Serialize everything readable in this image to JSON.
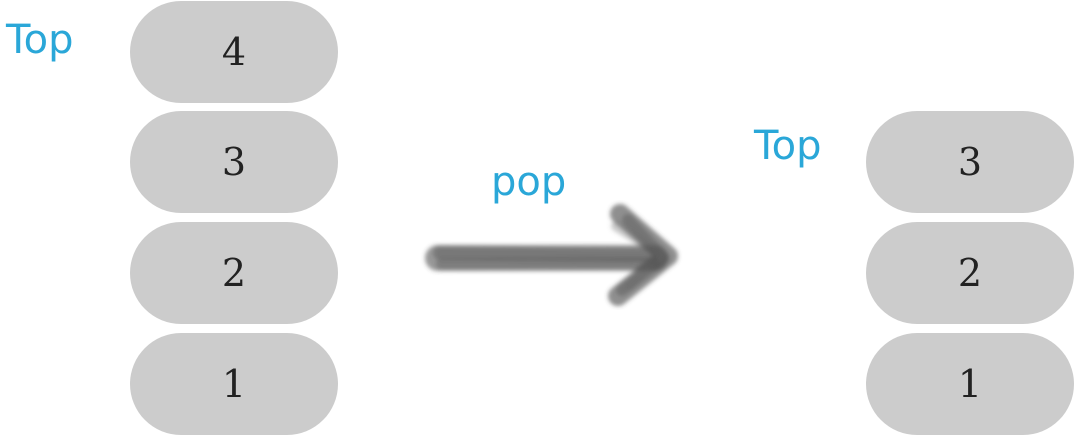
{
  "colors": {
    "label": "#2aa7d8",
    "item_fill": "#cccccc",
    "item_text": "#222222",
    "arrow": "#444444"
  },
  "before": {
    "top_label": "Top",
    "items": [
      "4",
      "3",
      "2",
      "1"
    ]
  },
  "operation": {
    "label": "pop",
    "icon": "right-arrow-icon"
  },
  "after": {
    "top_label": "Top",
    "items": [
      "3",
      "2",
      "1"
    ]
  }
}
